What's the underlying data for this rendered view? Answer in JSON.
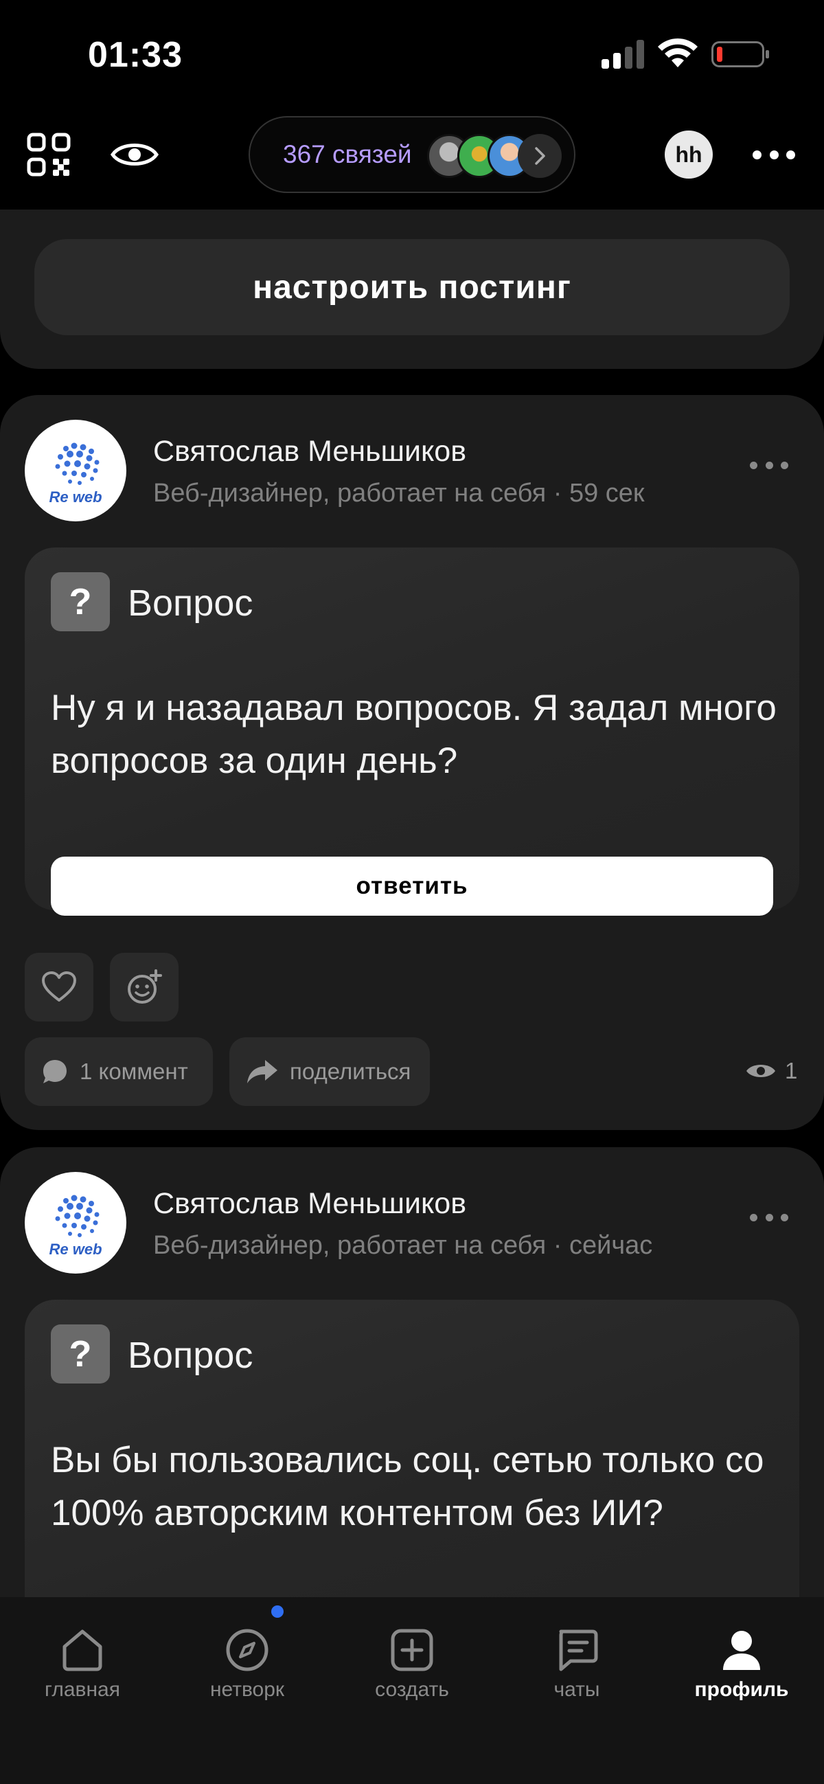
{
  "status_bar": {
    "time": "01:33"
  },
  "header": {
    "connections_label": "367 связей",
    "profile_badge": "hh"
  },
  "posting": {
    "button_label": "настроить постинг"
  },
  "posts": [
    {
      "author": "Святослав Меньшиков",
      "meta": "Веб-дизайнер, работает на себя · 59 сек",
      "avatar_text": "Re web",
      "question_label": "Вопрос",
      "question_text": "Ну я и назадавал вопросов. Я задал много вопросов за один день?",
      "answer_label": "ответить",
      "comment_label": "1 коммент",
      "share_label": "поделиться",
      "views": "1"
    },
    {
      "author": "Святослав Меньшиков",
      "meta": "Веб-дизайнер, работает на себя · сейчас",
      "avatar_text": "Re web",
      "question_label": "Вопрос",
      "question_text": "Вы бы пользовались соц. сетью только со 100% авторским контентом без ИИ?"
    }
  ],
  "nav": {
    "items": [
      {
        "label": "главная",
        "icon": "home-icon"
      },
      {
        "label": "нетворк",
        "icon": "compass-icon"
      },
      {
        "label": "создать",
        "icon": "plus-square-icon"
      },
      {
        "label": "чаты",
        "icon": "chat-icon"
      },
      {
        "label": "профиль",
        "icon": "profile-icon"
      }
    ],
    "active_index": 4
  },
  "colors": {
    "accent_purple": "#b69cff",
    "badge_blue": "#2f6ef2",
    "card_bg": "#1c1c1c"
  }
}
